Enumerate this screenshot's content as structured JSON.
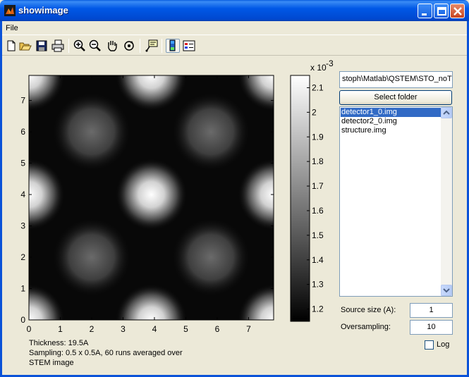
{
  "window": {
    "title": "showimage"
  },
  "menu": {
    "file": "File"
  },
  "toolbar": {
    "buttons": [
      "new-icon",
      "open-icon",
      "save-icon",
      "print-icon",
      "zoom-in-icon",
      "zoom-out-icon",
      "pan-icon",
      "rotate-3d-icon",
      "data-cursor-icon",
      "colorbar-icon",
      "legend-icon"
    ]
  },
  "plot": {
    "x_ticks": [
      "0",
      "1",
      "2",
      "3",
      "4",
      "5",
      "6",
      "7"
    ],
    "y_ticks": [
      "0",
      "1",
      "2",
      "3",
      "4",
      "5",
      "6",
      "7"
    ],
    "colorbar_multiplier": "x 10",
    "colorbar_exponent": "-3",
    "colorbar_ticks": [
      "1.2",
      "1.3",
      "1.4",
      "1.5",
      "1.6",
      "1.7",
      "1.8",
      "1.9",
      "2",
      "2.1"
    ]
  },
  "chart_data": {
    "type": "heatmap",
    "title": "",
    "xlabel": "",
    "ylabel": "",
    "xlim": [
      0,
      7.8
    ],
    "ylim": [
      0,
      7.8
    ],
    "colormap": "gray",
    "clim": [
      0.00115,
      0.00215
    ],
    "bright_spots": [
      {
        "x": 0,
        "y": 0
      },
      {
        "x": 7.8,
        "y": 0
      },
      {
        "x": 0,
        "y": 7.8
      },
      {
        "x": 7.8,
        "y": 7.8
      },
      {
        "x": 3.9,
        "y": 4.0
      },
      {
        "x": 0,
        "y": 4.0
      },
      {
        "x": 7.8,
        "y": 4.0
      },
      {
        "x": 3.9,
        "y": 0
      },
      {
        "x": 3.9,
        "y": 7.8
      }
    ],
    "medium_spots": [
      {
        "x": 2.0,
        "y": 2.0
      },
      {
        "x": 5.8,
        "y": 2.0
      },
      {
        "x": 2.0,
        "y": 6.0
      },
      {
        "x": 5.8,
        "y": 6.0
      }
    ]
  },
  "panel": {
    "path": "stoph\\Matlab\\QSTEM\\STO_noTilt",
    "select_folder": "Select folder",
    "files": [
      "detector1_0.img",
      "detector2_0.img",
      "structure.img"
    ],
    "selected_index": 0,
    "source_size_label": "Source size (A):",
    "source_size_value": "1",
    "oversampling_label": "Oversampling:",
    "oversampling_value": "10",
    "log_label": "Log"
  },
  "info": {
    "thickness": "Thickness: 19.5A",
    "sampling": "Sampling: 0.5 x 0.5A, 60 runs averaged over",
    "image_type": "STEM image"
  }
}
